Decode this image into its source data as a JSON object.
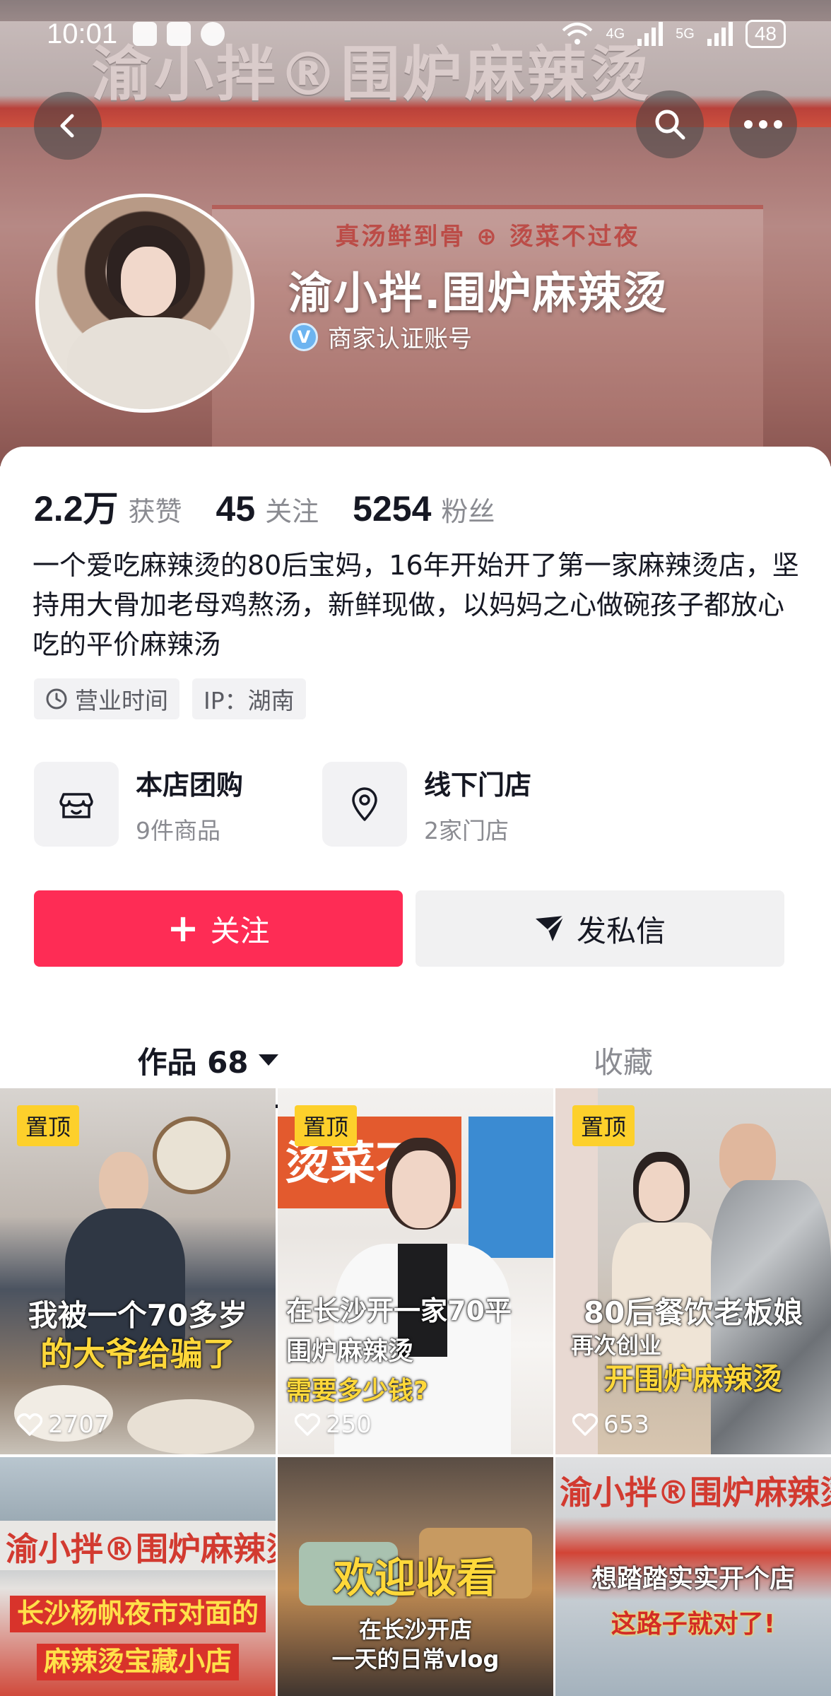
{
  "status_bar": {
    "time": "10:01",
    "network_1": "4G",
    "network_2": "5G",
    "battery": "48"
  },
  "cover": {
    "sign_text": "渝小拌®围炉麻辣烫",
    "banner_text": "真汤鲜到骨 ⊕ 烫菜不过夜"
  },
  "profile": {
    "name": "渝小拌.围炉麻辣烫",
    "verify_label": "商家认证账号",
    "verify_badge": "V"
  },
  "stats": [
    {
      "value": "2.2万",
      "label": "获赞"
    },
    {
      "value": "45",
      "label": "关注"
    },
    {
      "value": "5254",
      "label": "粉丝"
    }
  ],
  "bio": "一个爱吃麻辣烫的80后宝妈，16年开始开了第一家麻辣烫店，坚持用大骨加老母鸡熬汤，新鲜现做，以妈妈之心做碗孩子都放心吃的平价麻辣汤",
  "tags": {
    "hours": "营业时间",
    "ip": "IP：湖南"
  },
  "services": [
    {
      "title": "本店团购",
      "sub": "9件商品"
    },
    {
      "title": "线下门店",
      "sub": "2家门店"
    }
  ],
  "buttons": {
    "follow": "关注",
    "follow_icon": "+",
    "message": "发私信"
  },
  "tabs": {
    "works": "作品 68",
    "favorites": "收藏"
  },
  "videos": [
    {
      "pinned": "置顶",
      "caption_1": "我被一个70多岁",
      "caption_2": "的大爷给骗了",
      "likes": "2707"
    },
    {
      "pinned": "置顶",
      "caption_1": "在长沙开一家70平",
      "caption_2": "围炉麻辣烫",
      "caption_3": "需要多少钱?",
      "likes": "250"
    },
    {
      "pinned": "置顶",
      "caption_1": "80后餐饮老板娘",
      "caption_2": "再次创业",
      "caption_3": "开围炉麻辣烫",
      "likes": "653"
    },
    {
      "caption_1": "长沙杨帆夜市对面的",
      "caption_2": "麻辣烫宝藏小店",
      "sign": "渝小拌®围炉麻辣烫"
    },
    {
      "caption_1": "欢迎收看",
      "caption_2": "在长沙开店",
      "caption_3": "一天的日常vlog"
    },
    {
      "caption_1": "想踏踏实实开个店",
      "caption_2": "这路子就对了!",
      "sign": "渝小拌®围炉麻辣烫"
    }
  ],
  "colors": {
    "accent": "#fe2c55",
    "pin": "#fdd02b",
    "text": "#161823",
    "muted": "#8a8b91"
  }
}
